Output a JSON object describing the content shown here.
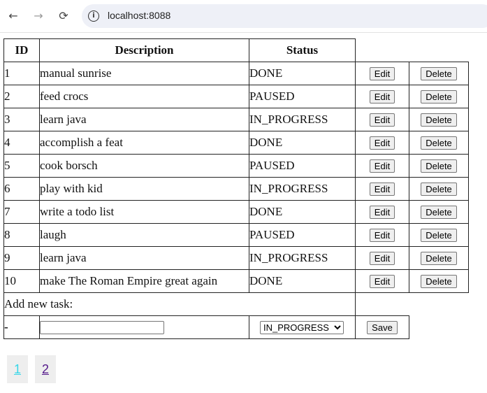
{
  "browser": {
    "url": "localhost:8088",
    "back_icon": "←",
    "forward_icon": "→",
    "reload_icon": "⟳",
    "info_icon": "i"
  },
  "table": {
    "headers": {
      "id": "ID",
      "description": "Description",
      "status": "Status"
    },
    "rows": [
      {
        "id": "1",
        "description": "manual sunrise",
        "status": "DONE"
      },
      {
        "id": "2",
        "description": "feed crocs",
        "status": "PAUSED"
      },
      {
        "id": "3",
        "description": "learn java",
        "status": "IN_PROGRESS"
      },
      {
        "id": "4",
        "description": "accomplish a feat",
        "status": "DONE"
      },
      {
        "id": "5",
        "description": "cook borsch",
        "status": "PAUSED"
      },
      {
        "id": "6",
        "description": "play with kid",
        "status": "IN_PROGRESS"
      },
      {
        "id": "7",
        "description": "write a todo list",
        "status": "DONE"
      },
      {
        "id": "8",
        "description": "laugh",
        "status": "PAUSED"
      },
      {
        "id": "9",
        "description": "learn java",
        "status": "IN_PROGRESS"
      },
      {
        "id": "10",
        "description": "make The Roman Empire great again",
        "status": "DONE"
      }
    ],
    "edit_label": "Edit",
    "delete_label": "Delete"
  },
  "new_task": {
    "heading": "Add new task:",
    "id_placeholder": "-",
    "description_value": "",
    "status_selected": "IN_PROGRESS",
    "save_label": "Save"
  },
  "pagination": {
    "pages": [
      "1",
      "2"
    ],
    "active_page": "1"
  }
}
